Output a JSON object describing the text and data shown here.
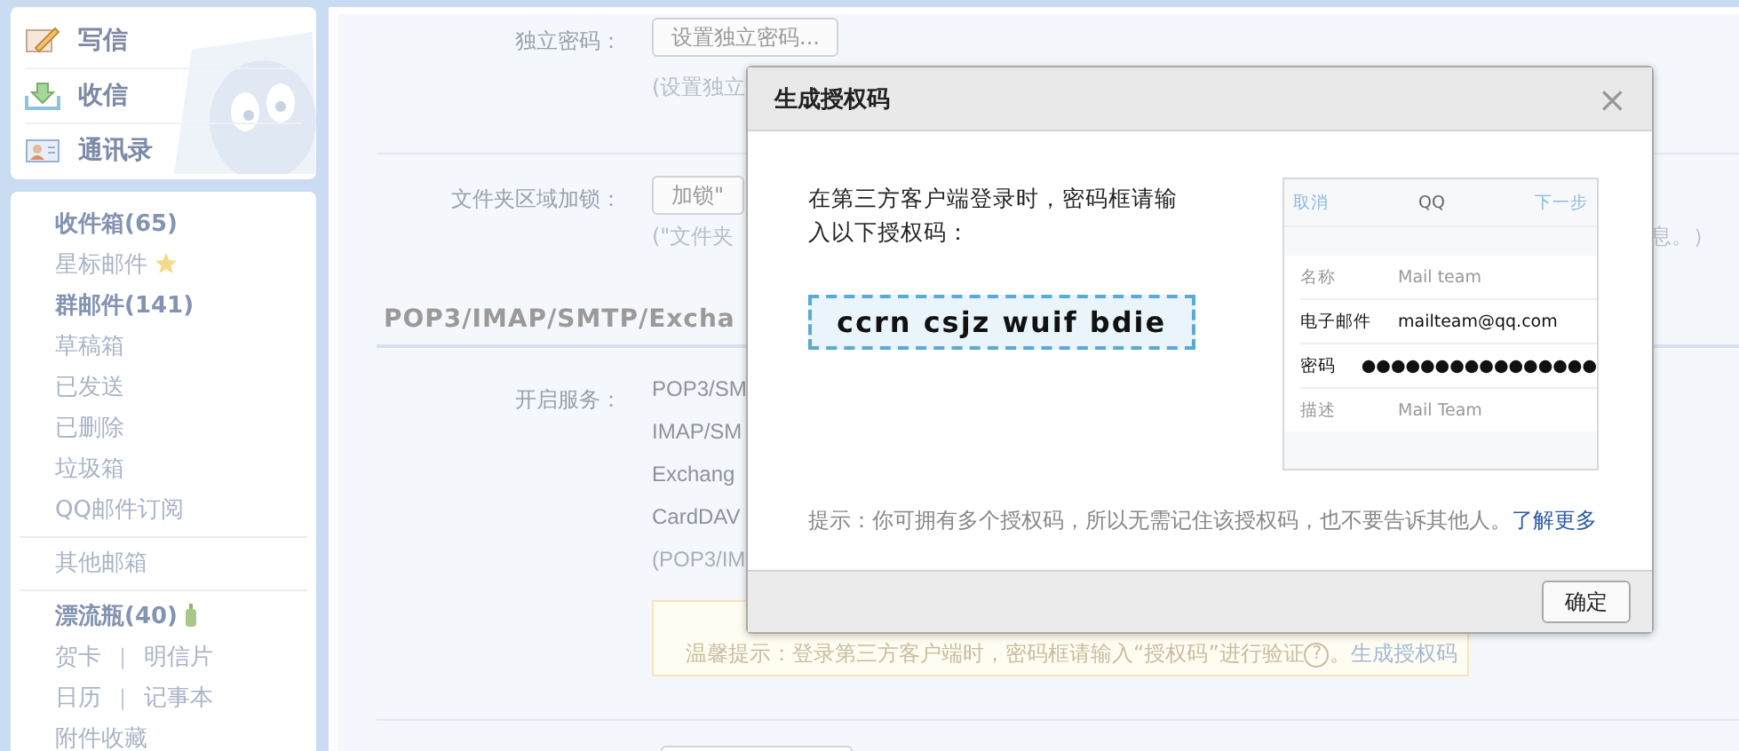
{
  "sidebar": {
    "actions": [
      {
        "label": "写信"
      },
      {
        "label": "收信"
      },
      {
        "label": "通讯录"
      }
    ],
    "folder_groups": [
      [
        {
          "kind": "link",
          "label": "收件箱(65)",
          "bold": true
        },
        {
          "kind": "starred",
          "label": "星标邮件",
          "bold": false
        },
        {
          "kind": "link",
          "label": "群邮件(141)",
          "bold": true
        },
        {
          "kind": "link",
          "label": "草稿箱",
          "bold": false
        },
        {
          "kind": "link",
          "label": "已发送",
          "bold": false
        },
        {
          "kind": "link",
          "label": "已删除",
          "bold": false
        },
        {
          "kind": "link",
          "label": "垃圾箱",
          "bold": false
        },
        {
          "kind": "link",
          "label": "QQ邮件订阅",
          "bold": false
        }
      ],
      [
        {
          "kind": "link",
          "label": "其他邮箱",
          "bold": false
        }
      ],
      [
        {
          "kind": "bottle",
          "label": "漂流瓶(40)",
          "bold": true
        },
        {
          "kind": "pair",
          "links": [
            "贺卡",
            "明信片"
          ],
          "separator": "|"
        },
        {
          "kind": "pair",
          "links": [
            "日历",
            "记事本"
          ],
          "separator": "|"
        },
        {
          "kind": "link",
          "label": "附件收藏",
          "bold": false
        }
      ]
    ]
  },
  "settings": [
    {
      "label": "独立密码：",
      "button": "设置独立密码...",
      "note": "(设置独立"
    },
    {
      "label": "文件夹区域加锁：",
      "button": "加锁\"",
      "note": "(\"文件夹",
      "note_tail": "息。）"
    }
  ],
  "section_title": "POP3/IMAP/SMTP/Excha",
  "services": {
    "label": "开启服务：",
    "lines": [
      "POP3/SM",
      "IMAP/SM",
      "Exchang",
      "CardDAV"
    ],
    "note": "(POP3/IM",
    "tip": "温馨提示：登录第三方客户端时，密码框请输入“授权码”进行验证",
    "tip_help": "?",
    "tip_end": "。",
    "tip_link": "生成授权码"
  },
  "dialog": {
    "title": "生成授权码",
    "close": "×",
    "instruction": "在第三方客户端登录时，密码框请输入以下授权码：",
    "code": "ccrn csjz wuif bdie",
    "phone": {
      "cancel": "取消",
      "title": "QQ",
      "next": "下一步",
      "rows": [
        {
          "label": "名称",
          "value": "Mail team",
          "emphasis": false
        },
        {
          "label": "电子邮件",
          "value": "mailteam@qq.com",
          "emphasis": true
        },
        {
          "label": "密码",
          "value": "●●●●●●●●●●●●●●●●",
          "emphasis": true
        },
        {
          "label": "描述",
          "value": "Mail Team",
          "emphasis": false
        }
      ]
    },
    "hint": "提示：你可拥有多个授权码，所以无需记住该授权码，也不要告诉其他人。",
    "hint_link": "了解更多",
    "ok": "确定"
  }
}
